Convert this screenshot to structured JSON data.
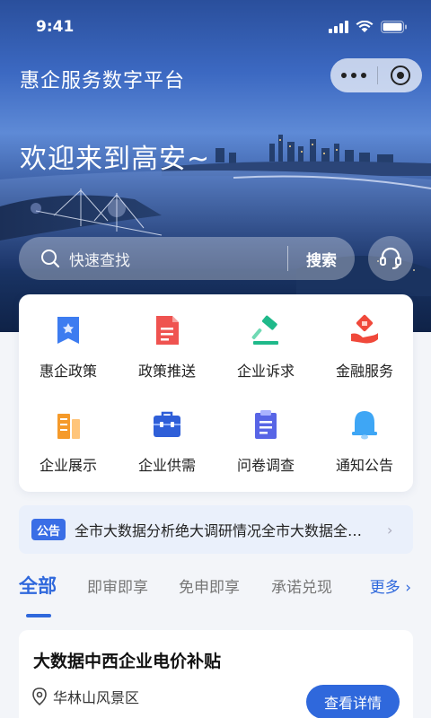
{
  "status_bar": {
    "time": "9:41"
  },
  "header": {
    "title": "惠企服务数字平台"
  },
  "hero": {
    "welcome": "欢迎来到高安~"
  },
  "search": {
    "placeholder": "快速查找",
    "button": "搜索"
  },
  "services": [
    {
      "label": "惠企政策",
      "icon": "policy-badge-icon",
      "color": "#3d7cf0"
    },
    {
      "label": "政策推送",
      "icon": "document-icon",
      "color": "#ef5350"
    },
    {
      "label": "企业诉求",
      "icon": "gavel-icon",
      "color": "#1fb98a"
    },
    {
      "label": "金融服务",
      "icon": "finance-icon",
      "color": "#f0493b"
    },
    {
      "label": "企业展示",
      "icon": "buildings-icon",
      "color": "#f59a2a"
    },
    {
      "label": "企业供需",
      "icon": "toolbox-icon",
      "color": "#2f5fd8"
    },
    {
      "label": "问卷调查",
      "icon": "clipboard-icon",
      "color": "#5865e6"
    },
    {
      "label": "通知公告",
      "icon": "bell-icon",
      "color": "#3ea6f5"
    }
  ],
  "notice": {
    "tag": "公告",
    "text": "全市大数据分析绝大调研情况全市大数据全…"
  },
  "tabs": {
    "items": [
      "全部",
      "即审即享",
      "免申即享",
      "承诺兑现"
    ],
    "more": "更多"
  },
  "item": {
    "title": "大数据中西企业电价补贴",
    "location": "华林山风景区",
    "button": "查看详情"
  },
  "colors": {
    "primary": "#2f68dc"
  }
}
